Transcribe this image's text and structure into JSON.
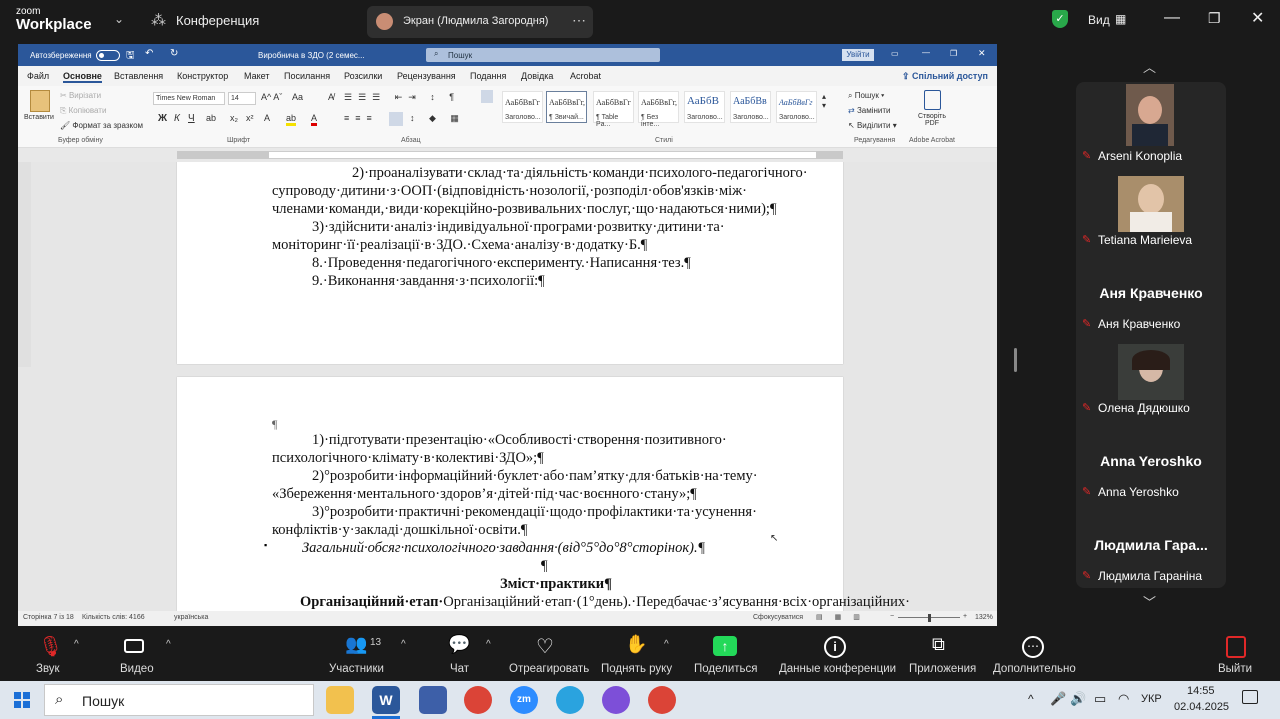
{
  "zoom": {
    "logo_line1": "zoom",
    "logo_line2": "Workplace",
    "meeting_title": "Конференция",
    "share_label": "Экран (Людмила Загородня)",
    "view_label": "Вид"
  },
  "word": {
    "autosave_label": "Автозбереження",
    "doc_title": "Виробнича в ЗДО (2 семес...",
    "search_placeholder": "Пошук",
    "signin_label": "Увійти",
    "share_button": "Спільний доступ",
    "menu_tabs": [
      "Файл",
      "Основне",
      "Вставлення",
      "Конструктор",
      "Макет",
      "Посилання",
      "Розсилки",
      "Рецензування",
      "Подання",
      "Довідка",
      "Acrobat"
    ],
    "clipboard": {
      "paste": "Вставити",
      "cut": "Вирізати",
      "copy": "Копіювати",
      "format_painter": "Формат за зразком",
      "group": "Буфер обміну"
    },
    "font": {
      "name": "Times New Roman",
      "size": "14",
      "group": "Шрифт"
    },
    "paragraph_group": "Абзац",
    "styles": {
      "items": [
        {
          "preview": "АаБбВвГг",
          "name": "Заголово..."
        },
        {
          "preview": "АаБбВвГг,",
          "name": "¶ Звичай..."
        },
        {
          "preview": "АаБбВвГг",
          "name": "¶ Table Pa..."
        },
        {
          "preview": "АаБбВвГг,",
          "name": "¶ Без інте..."
        },
        {
          "preview": "АаБбВ",
          "name": "Заголово..."
        },
        {
          "preview": "АаБбВв",
          "name": "Заголово..."
        },
        {
          "preview": "АаБбВвГг",
          "name": "Заголово..."
        }
      ],
      "group": "Стилі"
    },
    "editing": {
      "find": "Пошук",
      "replace": "Замінити",
      "select": "Виділити",
      "group": "Редагування"
    },
    "acrobat": {
      "create_pdf_line1": "Створіть",
      "create_pdf_line2": "PDF",
      "group": "Adobe Acrobat"
    },
    "page1_lines": [
      "2)·проаналізувати·склад·та·діяльність·команди·психолого-педагогічного·",
      "супроводу·дитини·з·ООП·(відповідність·нозології,·розподіл·обов'язків·між·",
      "членами·команди,·види·корекційно-розвивальних·послуг,·що·надаються·ними);¶",
      "3)·здійснити·аналіз·індивідуальної·програми·розвитку·дитини·та·",
      "моніторинг·її·реалізації·в·ЗДО.·Схема·аналізу·в·додатку·Б.¶",
      "8.·Проведення·педагогічного·експерименту.·Написання·тез.¶",
      "9.·Виконання·завдання·з·психології:¶"
    ],
    "page2_lines": [
      "¶",
      "1)·підготувати·презентацію·«Особливості·створення·позитивного·",
      "психологічного·клімату·в·колективі·ЗДО»;¶",
      "2)°розробити·інформаційний·буклет·або·пам’ятку·для·батьків·на·тему·",
      "«Збереження·ментального·здоров’я·дітей·під·час·воєнного·стану»;¶",
      "3)°розробити·практичні·рекомендації·щодо·профілактики·та·усунення·",
      "конфліктів·у·закладі·дошкільної·освіти.¶",
      "Загальний·обсяг·психологічного·завдання·(від°5°до°8°сторінок).¶",
      "¶",
      "Зміст·практики¶",
      "Організаційний·етап·(1°день).·Передбачає·з’ясування·всіх·організаційних·"
    ],
    "status": {
      "page": "Сторінка 7 із 18",
      "words": "Кількість слів: 4166",
      "language": "українська",
      "focus": "Сфокусуватися",
      "zoom": "132%"
    }
  },
  "participants": [
    {
      "name": "Arseni Konoplia",
      "has_video": true
    },
    {
      "name": "Tetiana Marieieva",
      "has_video": true
    },
    {
      "name": "Аня Кравченко",
      "display": "Аня Кравченко",
      "has_video": false
    },
    {
      "name": "Олена Дядюшко",
      "has_video": true
    },
    {
      "name": "Anna Yeroshko",
      "display": "Anna Yeroshko",
      "has_video": false
    },
    {
      "name": "Людмила Гаранiна",
      "display": "Людмила Гара...",
      "has_video": false
    }
  ],
  "toolbar": {
    "audio": "Звук",
    "video": "Видео",
    "participants": "Участники",
    "participants_count": "13",
    "chat": "Чат",
    "react": "Отреагировать",
    "raise_hand": "Поднять руку",
    "share": "Поделиться",
    "info": "Данные конференции",
    "apps": "Приложения",
    "more": "Дополнительно",
    "leave": "Выйти"
  },
  "taskbar": {
    "search": "Пошук",
    "lang": "УКР",
    "time": "14:55",
    "date": "02.04.2025"
  }
}
